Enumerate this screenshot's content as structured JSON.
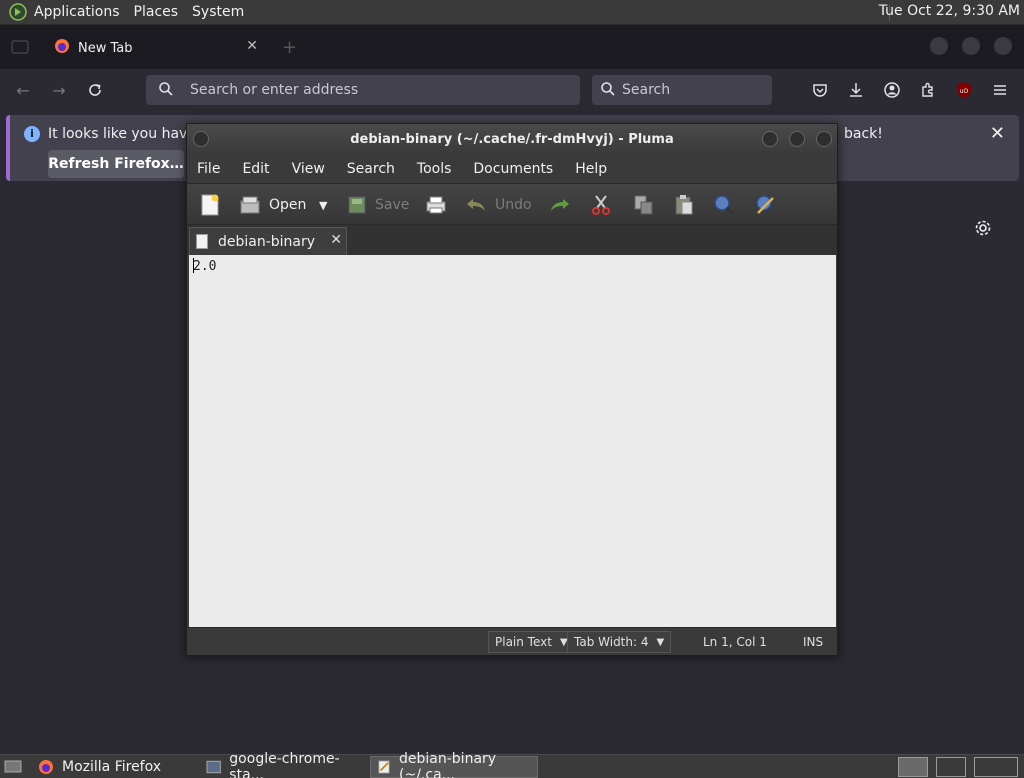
{
  "top_panel": {
    "menus": [
      "Applications",
      "Places",
      "System"
    ],
    "clock": "Tue Oct 22,  9:30 AM"
  },
  "firefox": {
    "tab": {
      "title": "New Tab",
      "close": "✕"
    },
    "url_placeholder": "Search or enter address",
    "search_placeholder": "Search",
    "notification": {
      "message": "It looks like you haven't",
      "message_tail": "back!",
      "refresh_button": "Refresh Firefox…",
      "close": "✕"
    }
  },
  "pluma": {
    "title": "debian-binary (~/.cache/.fr-dmHvyj) - Pluma",
    "menus": [
      "File",
      "Edit",
      "View",
      "Search",
      "Tools",
      "Documents",
      "Help"
    ],
    "toolbar": {
      "open": "Open",
      "save": "Save",
      "undo": "Undo"
    },
    "tab": {
      "label": "debian-binary",
      "close": "✕"
    },
    "content": "2.0",
    "status": {
      "syntax": "Plain Text",
      "tab_width": "Tab Width:  4",
      "position": "Ln 1, Col 1",
      "mode": "INS"
    }
  },
  "taskbar": {
    "tasks": [
      {
        "label": "Mozilla Firefox"
      },
      {
        "label": "google-chrome-sta..."
      },
      {
        "label": "debian-binary (~/.ca..."
      }
    ]
  },
  "colors": {
    "panel": "#3a3a3a",
    "firefox_bg": "#2b2a33",
    "accent": "#a06ad6"
  }
}
